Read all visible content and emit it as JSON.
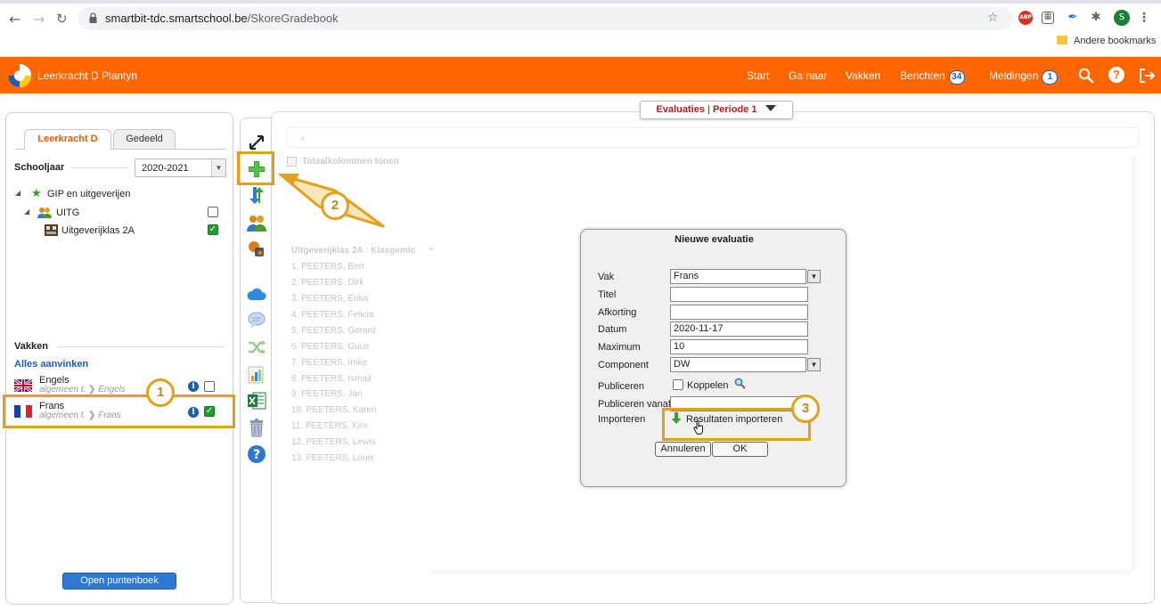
{
  "browser": {
    "url_host": "smartbit-tdc.smartschool.be",
    "url_path": "/SkoreGradebook",
    "bookmarks_label": "Andere bookmarks",
    "profile_initial": "S",
    "adblock_label": "ABP"
  },
  "header": {
    "title": "Leerkracht D Plantyn",
    "nav": {
      "start": "Start",
      "ganaar": "Ga naar",
      "vakken": "Vakken",
      "berichten": "Berichten",
      "berichten_count": "34",
      "meldingen": "Meldingen",
      "meldingen_count": "1"
    },
    "brand_color": "#ff6600"
  },
  "left_panel": {
    "tabs": [
      "Leerkracht D",
      "Gedeeld"
    ],
    "schooljaar_label": "Schooljaar",
    "schooljaar_value": "2020-2021",
    "tree": [
      {
        "label": "GIP en uitgeverijen",
        "level": 0
      },
      {
        "label": "UITG",
        "level": 1,
        "checked": false
      },
      {
        "label": "Uitgeverijklas 2A",
        "level": 2,
        "checked": true
      }
    ],
    "vakken_label": "Vakken",
    "alles_aanvinken": "Alles aanvinken",
    "vakken": [
      {
        "name": "Engels",
        "path": "algemeen t.",
        "sub": "Engels",
        "checked": false
      },
      {
        "name": "Frans",
        "path": "algemeen t.",
        "sub": "Frans",
        "checked": true
      }
    ],
    "open_button": "Open puntenboek"
  },
  "toolbar": {
    "icons": [
      "expand-icon",
      "add-icon",
      "sort-icon",
      "users-icon",
      "tags-icon",
      "cloud-icon",
      "comment-icon",
      "shuffle-icon",
      "chart-icon",
      "excel-icon",
      "trash-icon",
      "help-icon"
    ]
  },
  "main": {
    "dropdown_left": "Evaluaties",
    "dropdown_sep": "|",
    "dropdown_right": "Periode 1",
    "totaal_label": "Totaalkolommen tonen",
    "class_header": "Uitgeverijklas 2A : Klasgemic",
    "students": [
      "1. PEETERS, Bert",
      "2. PEETERS, Dirk",
      "3. PEETERS, Erika",
      "4. PEETERS, Felicia",
      "5. PEETERS, Gerard",
      "6. PEETERS, Guus",
      "7. PEETERS, Imke",
      "8. PEETERS, Ismail",
      "9. PEETERS, Jari",
      "10. PEETERS, Karen",
      "11. PEETERS, Kim",
      "12. PEETERS, Lewis",
      "13. PEETERS, Louis"
    ]
  },
  "dialog": {
    "title": "Nieuwe evaluatie",
    "vak_label": "Vak",
    "vak_value": "Frans",
    "titel_label": "Titel",
    "titel_value": "",
    "afkorting_label": "Afkorting",
    "afkorting_value": "",
    "datum_label": "Datum",
    "datum_value": "2020-11-17",
    "maximum_label": "Maximum",
    "maximum_value": "10",
    "component_label": "Component",
    "component_value": "DW",
    "publiceren_label": "Publiceren",
    "koppelen_label": "Koppelen",
    "publiceren_vanaf_label": "Publiceren vanaf",
    "importeren_label": "Importeren",
    "importeren_link": "Resultaten importeren",
    "annuleren": "Annuleren",
    "ok": "OK"
  },
  "callouts": {
    "one": "1",
    "two": "2",
    "three": "3",
    "color": "#e3a01a"
  }
}
